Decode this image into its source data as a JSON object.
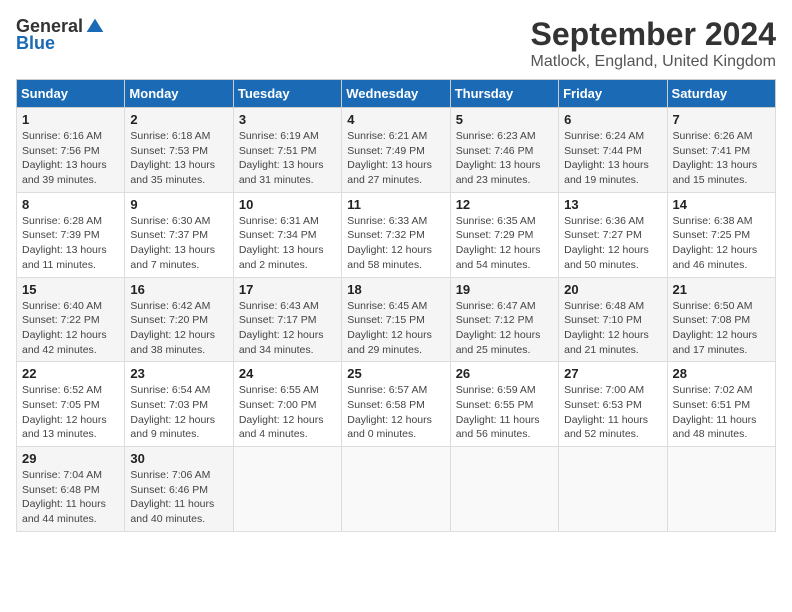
{
  "logo": {
    "general": "General",
    "blue": "Blue"
  },
  "header": {
    "month": "September 2024",
    "location": "Matlock, England, United Kingdom"
  },
  "days_of_week": [
    "Sunday",
    "Monday",
    "Tuesday",
    "Wednesday",
    "Thursday",
    "Friday",
    "Saturday"
  ],
  "weeks": [
    [
      {
        "day": "1",
        "sunrise": "Sunrise: 6:16 AM",
        "sunset": "Sunset: 7:56 PM",
        "daylight": "Daylight: 13 hours and 39 minutes."
      },
      {
        "day": "2",
        "sunrise": "Sunrise: 6:18 AM",
        "sunset": "Sunset: 7:53 PM",
        "daylight": "Daylight: 13 hours and 35 minutes."
      },
      {
        "day": "3",
        "sunrise": "Sunrise: 6:19 AM",
        "sunset": "Sunset: 7:51 PM",
        "daylight": "Daylight: 13 hours and 31 minutes."
      },
      {
        "day": "4",
        "sunrise": "Sunrise: 6:21 AM",
        "sunset": "Sunset: 7:49 PM",
        "daylight": "Daylight: 13 hours and 27 minutes."
      },
      {
        "day": "5",
        "sunrise": "Sunrise: 6:23 AM",
        "sunset": "Sunset: 7:46 PM",
        "daylight": "Daylight: 13 hours and 23 minutes."
      },
      {
        "day": "6",
        "sunrise": "Sunrise: 6:24 AM",
        "sunset": "Sunset: 7:44 PM",
        "daylight": "Daylight: 13 hours and 19 minutes."
      },
      {
        "day": "7",
        "sunrise": "Sunrise: 6:26 AM",
        "sunset": "Sunset: 7:41 PM",
        "daylight": "Daylight: 13 hours and 15 minutes."
      }
    ],
    [
      {
        "day": "8",
        "sunrise": "Sunrise: 6:28 AM",
        "sunset": "Sunset: 7:39 PM",
        "daylight": "Daylight: 13 hours and 11 minutes."
      },
      {
        "day": "9",
        "sunrise": "Sunrise: 6:30 AM",
        "sunset": "Sunset: 7:37 PM",
        "daylight": "Daylight: 13 hours and 7 minutes."
      },
      {
        "day": "10",
        "sunrise": "Sunrise: 6:31 AM",
        "sunset": "Sunset: 7:34 PM",
        "daylight": "Daylight: 13 hours and 2 minutes."
      },
      {
        "day": "11",
        "sunrise": "Sunrise: 6:33 AM",
        "sunset": "Sunset: 7:32 PM",
        "daylight": "Daylight: 12 hours and 58 minutes."
      },
      {
        "day": "12",
        "sunrise": "Sunrise: 6:35 AM",
        "sunset": "Sunset: 7:29 PM",
        "daylight": "Daylight: 12 hours and 54 minutes."
      },
      {
        "day": "13",
        "sunrise": "Sunrise: 6:36 AM",
        "sunset": "Sunset: 7:27 PM",
        "daylight": "Daylight: 12 hours and 50 minutes."
      },
      {
        "day": "14",
        "sunrise": "Sunrise: 6:38 AM",
        "sunset": "Sunset: 7:25 PM",
        "daylight": "Daylight: 12 hours and 46 minutes."
      }
    ],
    [
      {
        "day": "15",
        "sunrise": "Sunrise: 6:40 AM",
        "sunset": "Sunset: 7:22 PM",
        "daylight": "Daylight: 12 hours and 42 minutes."
      },
      {
        "day": "16",
        "sunrise": "Sunrise: 6:42 AM",
        "sunset": "Sunset: 7:20 PM",
        "daylight": "Daylight: 12 hours and 38 minutes."
      },
      {
        "day": "17",
        "sunrise": "Sunrise: 6:43 AM",
        "sunset": "Sunset: 7:17 PM",
        "daylight": "Daylight: 12 hours and 34 minutes."
      },
      {
        "day": "18",
        "sunrise": "Sunrise: 6:45 AM",
        "sunset": "Sunset: 7:15 PM",
        "daylight": "Daylight: 12 hours and 29 minutes."
      },
      {
        "day": "19",
        "sunrise": "Sunrise: 6:47 AM",
        "sunset": "Sunset: 7:12 PM",
        "daylight": "Daylight: 12 hours and 25 minutes."
      },
      {
        "day": "20",
        "sunrise": "Sunrise: 6:48 AM",
        "sunset": "Sunset: 7:10 PM",
        "daylight": "Daylight: 12 hours and 21 minutes."
      },
      {
        "day": "21",
        "sunrise": "Sunrise: 6:50 AM",
        "sunset": "Sunset: 7:08 PM",
        "daylight": "Daylight: 12 hours and 17 minutes."
      }
    ],
    [
      {
        "day": "22",
        "sunrise": "Sunrise: 6:52 AM",
        "sunset": "Sunset: 7:05 PM",
        "daylight": "Daylight: 12 hours and 13 minutes."
      },
      {
        "day": "23",
        "sunrise": "Sunrise: 6:54 AM",
        "sunset": "Sunset: 7:03 PM",
        "daylight": "Daylight: 12 hours and 9 minutes."
      },
      {
        "day": "24",
        "sunrise": "Sunrise: 6:55 AM",
        "sunset": "Sunset: 7:00 PM",
        "daylight": "Daylight: 12 hours and 4 minutes."
      },
      {
        "day": "25",
        "sunrise": "Sunrise: 6:57 AM",
        "sunset": "Sunset: 6:58 PM",
        "daylight": "Daylight: 12 hours and 0 minutes."
      },
      {
        "day": "26",
        "sunrise": "Sunrise: 6:59 AM",
        "sunset": "Sunset: 6:55 PM",
        "daylight": "Daylight: 11 hours and 56 minutes."
      },
      {
        "day": "27",
        "sunrise": "Sunrise: 7:00 AM",
        "sunset": "Sunset: 6:53 PM",
        "daylight": "Daylight: 11 hours and 52 minutes."
      },
      {
        "day": "28",
        "sunrise": "Sunrise: 7:02 AM",
        "sunset": "Sunset: 6:51 PM",
        "daylight": "Daylight: 11 hours and 48 minutes."
      }
    ],
    [
      {
        "day": "29",
        "sunrise": "Sunrise: 7:04 AM",
        "sunset": "Sunset: 6:48 PM",
        "daylight": "Daylight: 11 hours and 44 minutes."
      },
      {
        "day": "30",
        "sunrise": "Sunrise: 7:06 AM",
        "sunset": "Sunset: 6:46 PM",
        "daylight": "Daylight: 11 hours and 40 minutes."
      },
      {
        "day": "",
        "sunrise": "",
        "sunset": "",
        "daylight": ""
      },
      {
        "day": "",
        "sunrise": "",
        "sunset": "",
        "daylight": ""
      },
      {
        "day": "",
        "sunrise": "",
        "sunset": "",
        "daylight": ""
      },
      {
        "day": "",
        "sunrise": "",
        "sunset": "",
        "daylight": ""
      },
      {
        "day": "",
        "sunrise": "",
        "sunset": "",
        "daylight": ""
      }
    ]
  ]
}
